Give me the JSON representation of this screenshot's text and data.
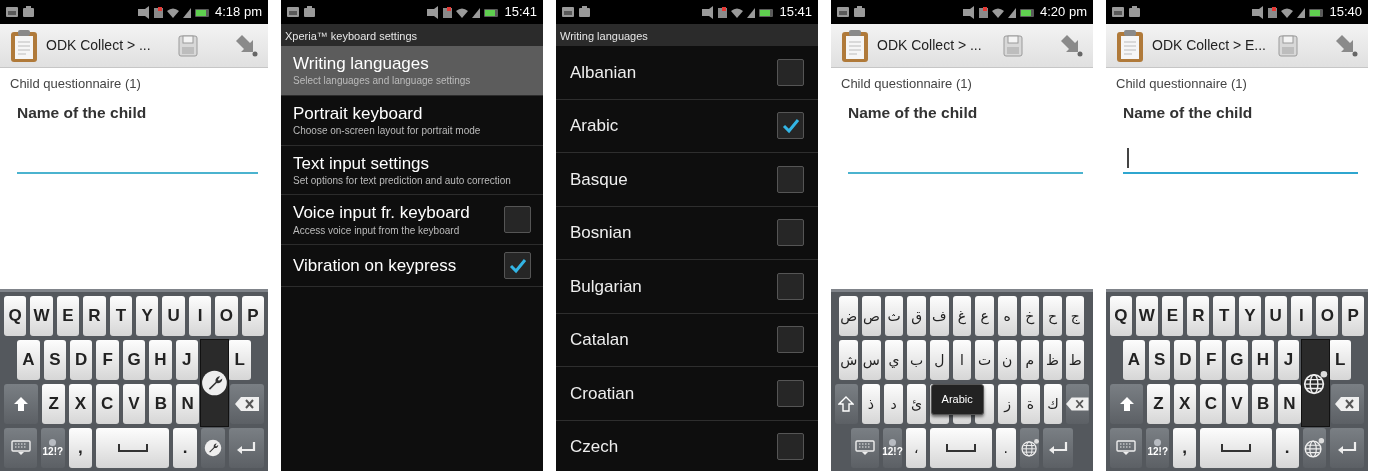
{
  "phones": [
    {
      "kind": "form",
      "status_bar": {
        "time": "4:18 pm"
      },
      "app_title": "ODK Collect > ...",
      "group_label": "Child questionnaire (1)",
      "question": "Name of the child",
      "answer": {
        "focused": false
      },
      "keyboard": {
        "kind": "latin",
        "popup": {
          "kind": "settings"
        },
        "rows": [
          {
            "keys": [
              "Q",
              "W",
              "E",
              "R",
              "T",
              "Y",
              "U",
              "I",
              "O",
              "P"
            ]
          },
          {
            "keys": [
              "A",
              "S",
              "D",
              "F",
              "G",
              "H",
              "J",
              {
                "kind": "covered"
              },
              "L"
            ]
          },
          {
            "keys": [
              {
                "kind": "shift"
              },
              "Z",
              "X",
              "C",
              "V",
              "B",
              "N",
              {
                "kind": "covered"
              },
              {
                "kind": "backspace"
              }
            ]
          },
          {
            "keys": [
              {
                "kind": "keyboard"
              },
              {
                "kind": "symbols",
                "label": "12!?"
              },
              ",",
              {
                "kind": "space"
              },
              ".",
              {
                "kind": "settings"
              },
              {
                "kind": "enter"
              }
            ]
          }
        ]
      }
    },
    {
      "kind": "settings",
      "status_bar": {
        "time": "15:41"
      },
      "screen_title": "Xperia™ keyboard settings",
      "items": [
        {
          "kind": "link",
          "title": "Writing languages",
          "summary": "Select languages and language settings",
          "selected": true
        },
        {
          "kind": "link",
          "title": "Portrait keyboard",
          "summary": "Choose on-screen layout for portrait mode",
          "selected": false
        },
        {
          "kind": "link",
          "title": "Text input settings",
          "summary": "Set options for text prediction and auto correction",
          "selected": false
        },
        {
          "kind": "toggle",
          "title": "Voice input fr. keyboard",
          "summary": "Access voice input from the keyboard",
          "selected": false,
          "checked": false
        },
        {
          "kind": "toggle",
          "title": "Vibration on keypress",
          "selected": false,
          "checked": true
        }
      ]
    },
    {
      "kind": "languages",
      "status_bar": {
        "time": "15:41"
      },
      "screen_title": "Writing languages",
      "items": [
        {
          "name": "Albanian",
          "checked": false
        },
        {
          "name": "Arabic",
          "checked": true
        },
        {
          "name": "Basque",
          "checked": false
        },
        {
          "name": "Bosnian",
          "checked": false
        },
        {
          "name": "Bulgarian",
          "checked": false
        },
        {
          "name": "Catalan",
          "checked": false
        },
        {
          "name": "Croatian",
          "checked": false
        },
        {
          "name": "Czech",
          "checked": false
        }
      ]
    },
    {
      "kind": "form",
      "status_bar": {
        "time": "4:20 pm"
      },
      "app_title": "ODK Collect > ...",
      "group_label": "Child questionnaire (1)",
      "question": "Name of the child",
      "answer": {
        "focused": false
      },
      "keyboard": {
        "kind": "arabic",
        "popup": {
          "kind": "tooltip",
          "label": "Arabic"
        },
        "rows": [
          {
            "kind": "rtl",
            "keys": [
              "ج",
              "ح",
              "خ",
              "ه",
              "ع",
              "غ",
              "ف",
              "ق",
              "ث",
              "ص",
              "ض"
            ]
          },
          {
            "kind": "rtl",
            "keys": [
              "ط",
              "ظ",
              "م",
              "ن",
              "ت",
              "ا",
              "ل",
              "ب",
              "ي",
              "س",
              "ش"
            ]
          },
          {
            "kind": "rtl",
            "keys": [
              {
                "kind": "backspace"
              },
              "ك",
              "ة",
              "ز",
              {
                "kind": "covered"
              },
              {
                "kind": "covered"
              },
              {
                "kind": "covered"
              },
              "ئ",
              "د",
              "ذ",
              {
                "kind": "shift"
              }
            ]
          },
          {
            "keys": [
              {
                "kind": "keyboard"
              },
              {
                "kind": "symbols",
                "label": "12!?"
              },
              "،",
              {
                "kind": "space"
              },
              ".",
              {
                "kind": "language"
              },
              {
                "kind": "enter"
              }
            ]
          }
        ]
      }
    },
    {
      "kind": "form",
      "status_bar": {
        "time": "15:40"
      },
      "app_title": "ODK Collect > E...",
      "group_label": "Child questionnaire (1)",
      "question": "Name of the child",
      "answer": {
        "focused": true
      },
      "keyboard": {
        "kind": "latin",
        "popup": {
          "kind": "language"
        },
        "rows": [
          {
            "keys": [
              "Q",
              "W",
              "E",
              "R",
              "T",
              "Y",
              "U",
              "I",
              "O",
              "P"
            ]
          },
          {
            "keys": [
              "A",
              "S",
              "D",
              "F",
              "G",
              "H",
              "J",
              {
                "kind": "covered"
              },
              "L"
            ]
          },
          {
            "keys": [
              {
                "kind": "shift"
              },
              "Z",
              "X",
              "C",
              "V",
              "B",
              "N",
              {
                "kind": "covered"
              },
              {
                "kind": "backspace"
              }
            ]
          },
          {
            "keys": [
              {
                "kind": "keyboard"
              },
              {
                "kind": "symbols",
                "label": "12!?"
              },
              ",",
              {
                "kind": "space"
              },
              ".",
              {
                "kind": "language"
              },
              {
                "kind": "enter"
              }
            ]
          }
        ]
      }
    }
  ]
}
